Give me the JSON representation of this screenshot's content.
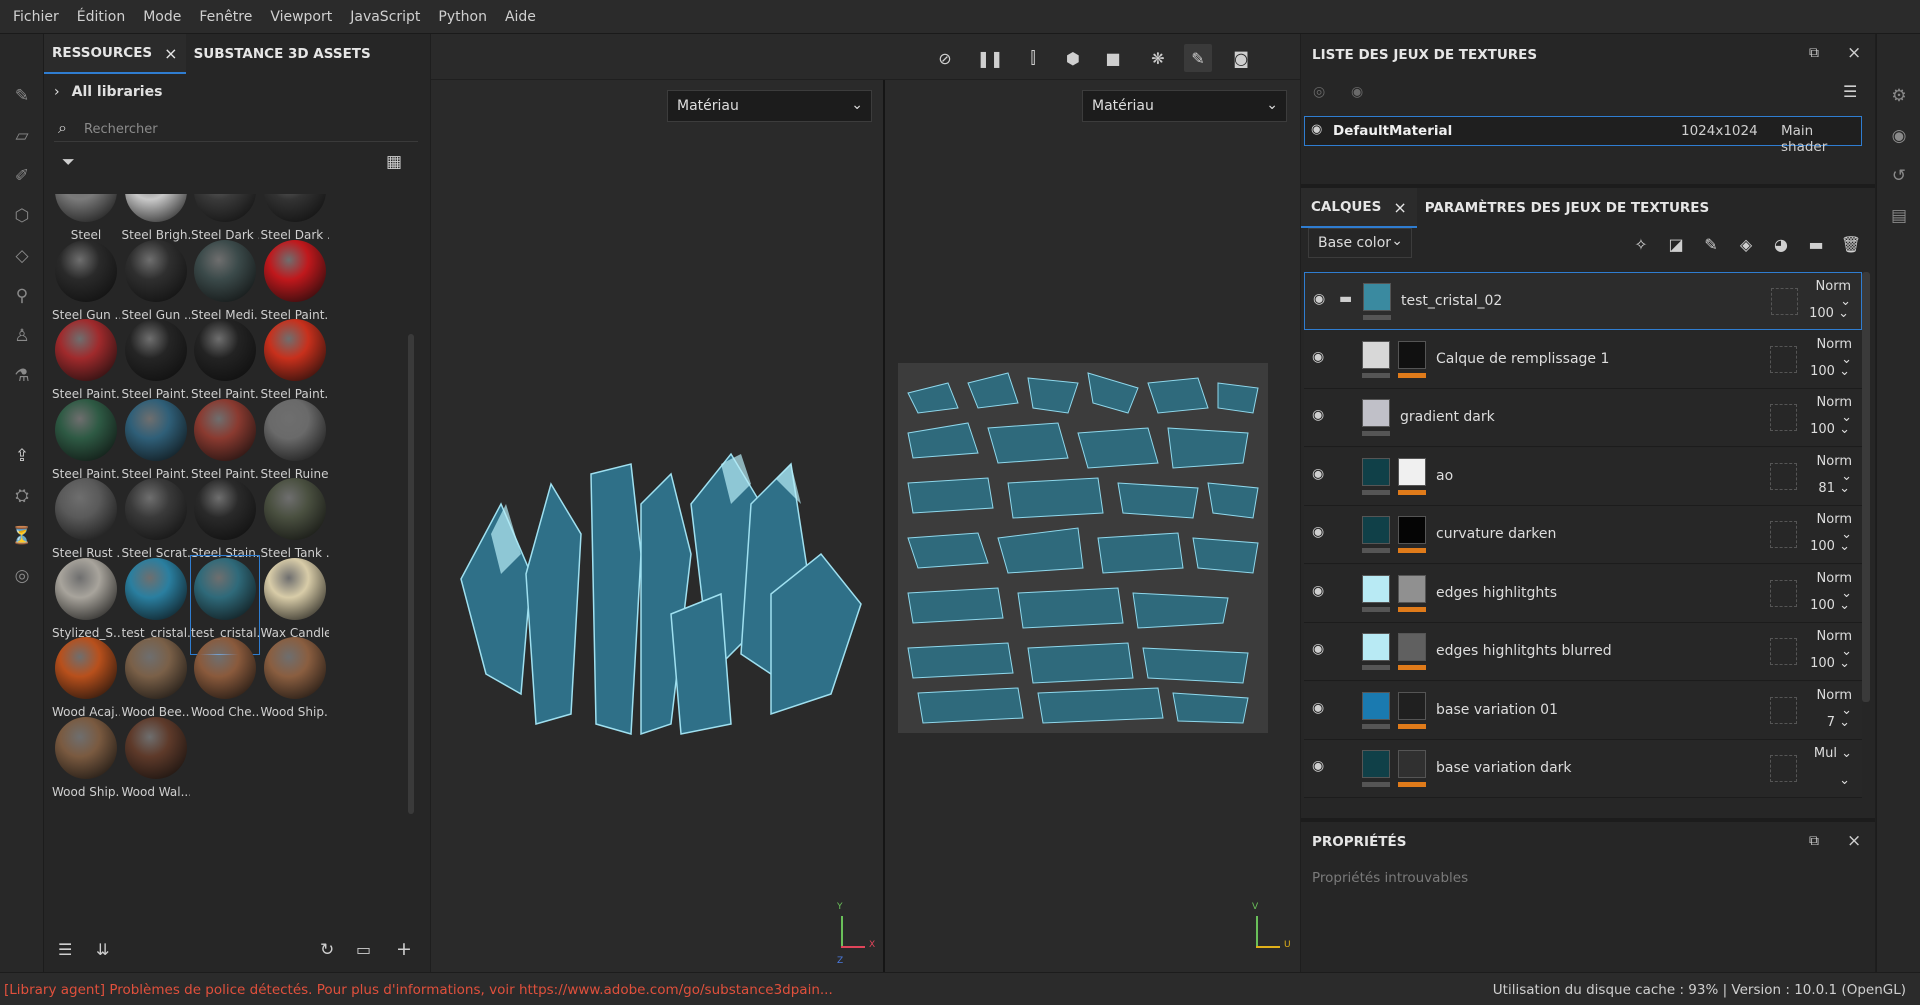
{
  "menu": [
    "Fichier",
    "Édition",
    "Mode",
    "Fenêtre",
    "Viewport",
    "JavaScript",
    "Python",
    "Aide"
  ],
  "resources": {
    "tabs": [
      "RESSOURCES",
      "SUBSTANCE 3D ASSETS"
    ],
    "library": "All libraries",
    "search_placeholder": "Rechercher",
    "materials": [
      {
        "label": "Steel",
        "color": "#7a7a7a"
      },
      {
        "label": "Steel Brigh...",
        "color": "#c8c8c8"
      },
      {
        "label": "Steel Dark ...",
        "color": "#3a3a3a"
      },
      {
        "label": "Steel Dark ...",
        "color": "#333333"
      },
      {
        "label": "Steel Gun ...",
        "color": "#2a2a2a"
      },
      {
        "label": "Steel Gun ...",
        "color": "#2f2f2f"
      },
      {
        "label": "Steel Medi...",
        "color": "#3b4a4a"
      },
      {
        "label": "Steel Paint...",
        "color": "#c0181c"
      },
      {
        "label": "Steel Paint...",
        "color": "#a02a2c"
      },
      {
        "label": "Steel Paint...",
        "color": "#252525"
      },
      {
        "label": "Steel Paint...",
        "color": "#232323"
      },
      {
        "label": "Steel Paint...",
        "color": "#c8301c"
      },
      {
        "label": "Steel Paint...",
        "color": "#2e5a44"
      },
      {
        "label": "Steel Paint...",
        "color": "#2f5f78"
      },
      {
        "label": "Steel Paint...",
        "color": "#8a3a30"
      },
      {
        "label": "Steel Ruined",
        "color": "#6a6a6a"
      },
      {
        "label": "Steel Rust ...",
        "color": "#5a5a5a"
      },
      {
        "label": "Steel Scrat...",
        "color": "#3a3a3a"
      },
      {
        "label": "Steel Stain...",
        "color": "#2a2a2a"
      },
      {
        "label": "Steel Tank ...",
        "color": "#4a5040"
      },
      {
        "label": "Stylized_S...",
        "color": "#a8a49c"
      },
      {
        "label": "test_cristal...",
        "color": "#2a7fa0"
      },
      {
        "label": "test_cristal...",
        "color": "#2f6a7a",
        "selected": true
      },
      {
        "label": "Wax Candle",
        "color": "#d8cca8"
      },
      {
        "label": "Wood Acaj...",
        "color": "#b8501c"
      },
      {
        "label": "Wood Bee...",
        "color": "#7a6048"
      },
      {
        "label": "Wood Che...",
        "color": "#8a5a3c"
      },
      {
        "label": "Wood Ship...",
        "color": "#8a5e40"
      },
      {
        "label": "Wood Ship...",
        "color": "#7a5a40"
      },
      {
        "label": "Wood Wal...",
        "color": "#5e3a2a"
      }
    ]
  },
  "viewport": {
    "dropdown_left": "Matériau",
    "dropdown_right": "Matériau",
    "axis_left": [
      "Y",
      "X",
      "Z"
    ],
    "axis_right": [
      "V",
      "U"
    ]
  },
  "texture_sets": {
    "title": "LISTE DES JEUX DE TEXTURES",
    "row": {
      "name": "DefaultMaterial",
      "size": "1024x1024",
      "shader": "Main shader"
    }
  },
  "layers_panel": {
    "tab_layers": "CALQUES",
    "tab_params": "PARAMÈTRES DES JEUX DE TEXTURES",
    "channel": "Base color",
    "layers": [
      {
        "name": "test_cristal_02",
        "blend": "Norm",
        "opacity": "100",
        "thumb": "#3a8aa0",
        "folder": true,
        "selected": true
      },
      {
        "name": "Calque de remplissage 1",
        "blend": "Norm",
        "opacity": "100",
        "thumb": "#d8d8d8",
        "mask": "#111111"
      },
      {
        "name": "gradient dark",
        "blend": "Norm",
        "opacity": "100",
        "thumb": "#c0c0c8"
      },
      {
        "name": "ao",
        "blend": "Norm",
        "opacity": "81",
        "thumb": "#104048",
        "mask": "#f0f0f0"
      },
      {
        "name": "curvature darken",
        "blend": "Norm",
        "opacity": "100",
        "thumb": "#104048",
        "mask": "#050505"
      },
      {
        "name": "edges highlitghts",
        "blend": "Norm",
        "opacity": "100",
        "thumb": "#b8eaf4",
        "mask": "#909090"
      },
      {
        "name": "edges highlitghts blurred",
        "blend": "Norm",
        "opacity": "100",
        "thumb": "#b8eaf4",
        "mask": "#606060"
      },
      {
        "name": "base variation 01",
        "blend": "Norm",
        "opacity": "7",
        "thumb": "#1a7ab0",
        "mask": "#202020"
      },
      {
        "name": "base variation dark",
        "blend": "Mul",
        "opacity": "",
        "thumb": "#104048",
        "mask": "#303030"
      }
    ]
  },
  "properties": {
    "title": "PROPRIÉTÉS",
    "empty": "Propriétés introuvables"
  },
  "status": {
    "left": "[Library agent] Problèmes de police détectés. Pour plus d'informations, voir https://www.adobe.com/go/substance3dpain...",
    "right": "Utilisation du disque cache :  93%  |  Version : 10.0.1 (OpenGL)"
  }
}
